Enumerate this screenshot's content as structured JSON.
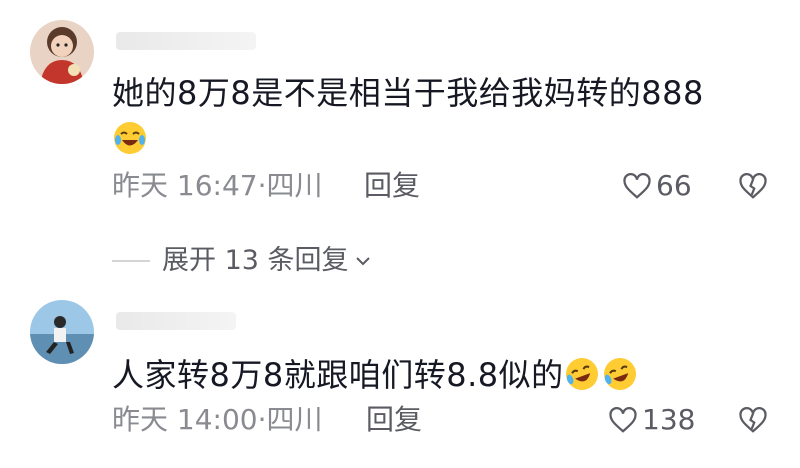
{
  "comments": [
    {
      "text": "她的8万8是不是相当于我给我妈转的888",
      "emojis": [
        "crying-laughing"
      ],
      "time_location": "昨天 16:47·四川",
      "reply_label": "回复",
      "likes": "66"
    },
    {
      "text": "人家转8万8就跟咱们转8.8似的",
      "emojis": [
        "rofl",
        "rofl"
      ],
      "time_location": "昨天 14:00·四川",
      "reply_label": "回复",
      "likes": "138"
    }
  ],
  "expand_replies": "展开 13 条回复",
  "icons": [
    "heart-outline-icon",
    "broken-heart-icon",
    "chevron-down-icon"
  ],
  "colors": {
    "text": "#161823",
    "meta": "#8a8b91",
    "action": "#5b5c63",
    "emoji": "#ffcc33"
  }
}
